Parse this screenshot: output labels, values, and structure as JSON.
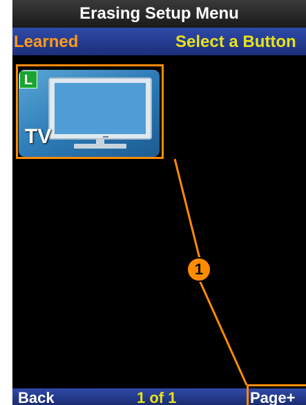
{
  "header": {
    "title": "Erasing Setup Menu"
  },
  "subheader": {
    "category": "Learned",
    "instruction": "Select a Button"
  },
  "tiles": [
    {
      "label": "TV",
      "badge": "L",
      "icon": "tv-icon"
    }
  ],
  "footer": {
    "back_label": "Back",
    "page_indicator": "1 of 1",
    "page_next_label": "Page+"
  },
  "callout": {
    "number": "1"
  },
  "colors": {
    "title_bg": "#2b2b2b",
    "sub_bar_bg": "#2a44a0",
    "category_text": "#ff9a1a",
    "instruction_text": "#e8e21a",
    "tile_bg": "#3b88c4",
    "badge_bg": "#1aa431",
    "highlight": "#ff8c00"
  }
}
